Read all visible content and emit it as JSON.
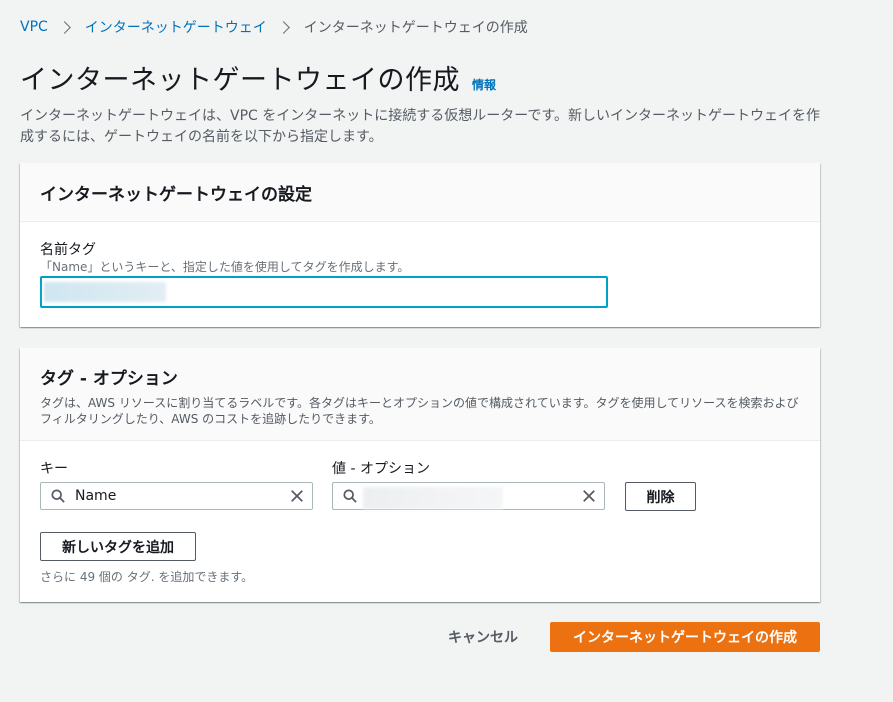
{
  "breadcrumb": {
    "items": [
      "VPC",
      "インターネットゲートウェイ"
    ],
    "current": "インターネットゲートウェイの作成"
  },
  "page": {
    "title": "インターネットゲートウェイの作成",
    "info_link": "情報",
    "description": "インターネットゲートウェイは、VPC をインターネットに接続する仮想ルーターです。新しいインターネットゲートウェイを作成するには、ゲートウェイの名前を以下から指定します。"
  },
  "settings_panel": {
    "title": "インターネットゲートウェイの設定",
    "name_tag_label": "名前タグ",
    "name_tag_description": "「Name」というキーと、指定した値を使用してタグを作成します。",
    "name_tag_value": ""
  },
  "tags_panel": {
    "title": "タグ - オプション",
    "description": "タグは、AWS リソースに割り当てるラベルです。各タグはキーとオプションの値で構成されています。タグを使用してリソースを検索およびフィルタリングしたり、AWS のコストを追跡したりできます。",
    "key_label": "キー",
    "value_label": "値 - オプション",
    "key_value": "Name",
    "tag_value": "",
    "remove_button": "削除",
    "add_tag_button": "新しいタグを追加",
    "remaining_text": "さらに 49 個の タグ. を追加できます。"
  },
  "footer": {
    "cancel_button": "キャンセル",
    "create_button": "インターネットゲートウェイの作成"
  },
  "colors": {
    "primary": "#ec7211",
    "link": "#0073bb",
    "focus": "#00a1c9"
  }
}
